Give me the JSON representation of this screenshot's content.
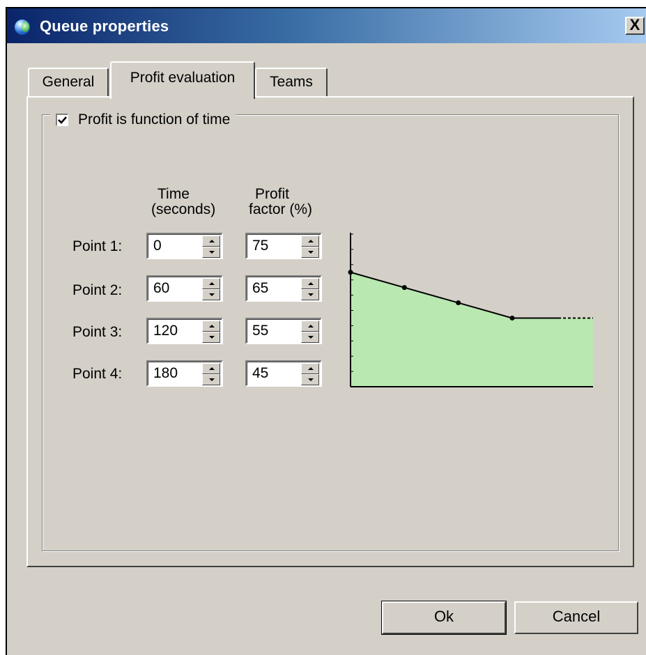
{
  "window": {
    "title": "Queue properties",
    "close_label": "X"
  },
  "tabs": [
    {
      "label": "General",
      "active": false
    },
    {
      "label": "Profit evaluation",
      "active": true
    },
    {
      "label": "Teams",
      "active": false
    }
  ],
  "group": {
    "checkbox_label": "Profit is function of time",
    "checked": true
  },
  "headers": {
    "time_line1": "Time",
    "time_line2": "(seconds)",
    "profit_line1": "Profit",
    "profit_line2": "factor (%)"
  },
  "points": [
    {
      "label": "Point 1:",
      "time": "0",
      "profit": "75"
    },
    {
      "label": "Point 2:",
      "time": "60",
      "profit": "65"
    },
    {
      "label": "Point 3:",
      "time": "120",
      "profit": "55"
    },
    {
      "label": "Point 4:",
      "time": "180",
      "profit": "45"
    }
  ],
  "buttons": {
    "ok": "Ok",
    "cancel": "Cancel"
  },
  "chart_data": {
    "type": "area",
    "x": [
      0,
      60,
      120,
      180
    ],
    "y": [
      75,
      65,
      55,
      45
    ],
    "xlim": [
      0,
      270
    ],
    "ylim": [
      0,
      100
    ],
    "extends_flat_after_last_point": true,
    "fill_color": "#b9e8b1",
    "line_color": "#000000"
  }
}
